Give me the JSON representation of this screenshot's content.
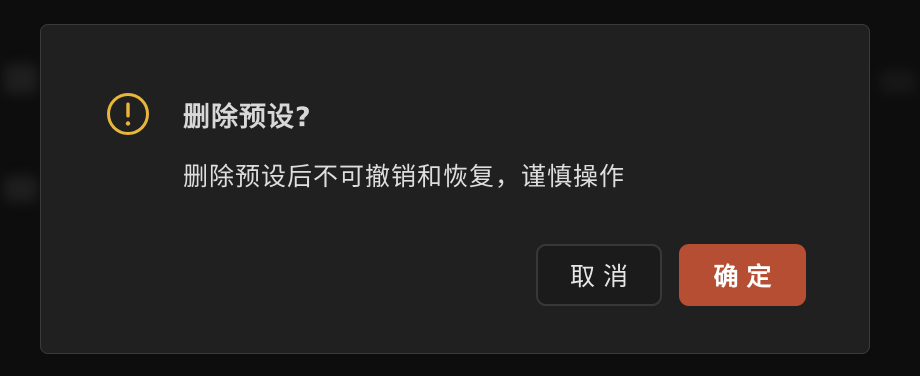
{
  "dialog": {
    "title": "删除预设?",
    "message": "删除预设后不可撤销和恢复，谨慎操作",
    "icon": "warning-icon",
    "accent_color": "#e8b63a"
  },
  "buttons": {
    "cancel_label": "取消",
    "confirm_label": "确定",
    "confirm_color": "#b54e32"
  }
}
